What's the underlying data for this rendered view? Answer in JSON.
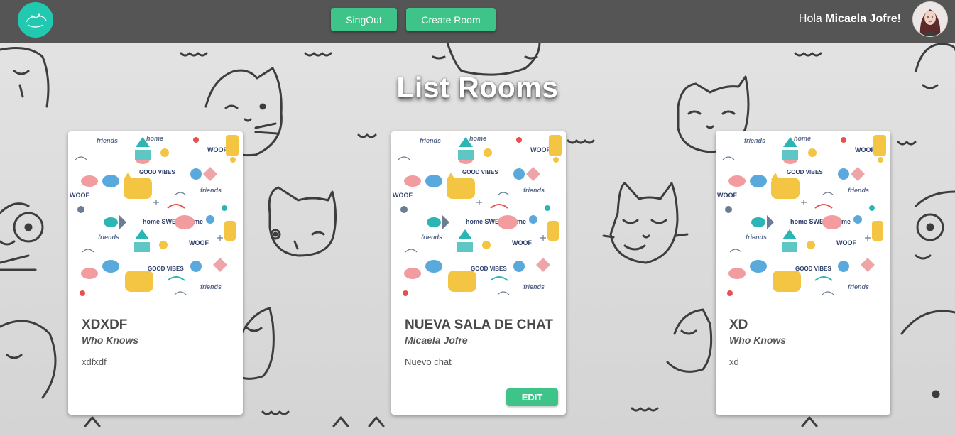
{
  "header": {
    "signout_label": "SingOut",
    "create_room_label": "Create Room",
    "greeting_prefix": "Hola ",
    "user_name": "Micaela Jofre!"
  },
  "page": {
    "title": "List Rooms"
  },
  "rooms": [
    {
      "title": "XDXDF",
      "owner": "Who Knows",
      "description": "xdfxdf",
      "edit_label": ""
    },
    {
      "title": "NUEVA SALA DE CHAT",
      "owner": "Micaela Jofre",
      "description": "Nuevo chat",
      "edit_label": "EDIT"
    },
    {
      "title": "XD",
      "owner": "Who Knows",
      "description": "xd",
      "edit_label": ""
    }
  ],
  "pattern_words": [
    "friends",
    "home",
    "WOOF",
    "GOOD VIBES",
    "home SWEET home"
  ],
  "colors": {
    "header_bg": "#555555",
    "accent_green": "#3ec488",
    "logo_teal": "#21c9b0",
    "page_bg": "#d9d9d9"
  },
  "icons": {
    "logo": "paw-logo-icon",
    "avatar": "user-avatar"
  }
}
